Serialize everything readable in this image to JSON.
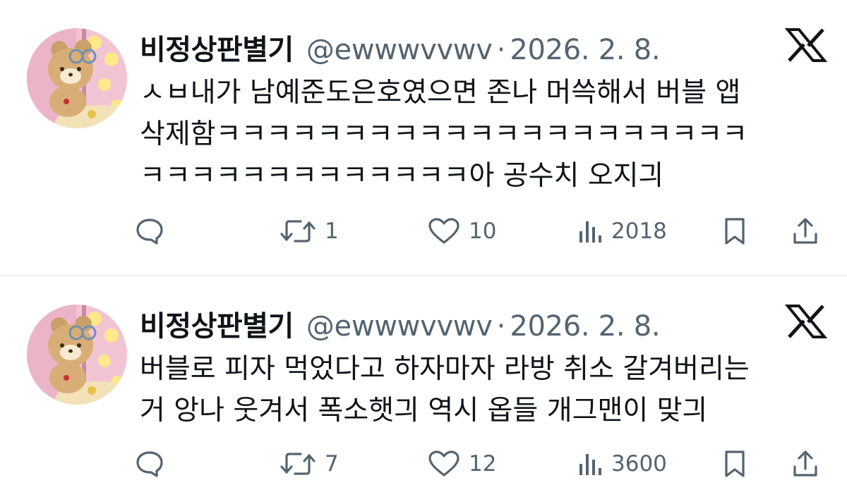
{
  "tweets": [
    {
      "display_name": "비정상판별기",
      "handle": "@ewwwvvwv",
      "separator": "·",
      "date": "2026. 2. 8.",
      "lines": [
        "ㅅㅂ내가 남예준도은호였으면 존나 머쓱해서 버블 앱",
        "삭제함ㅋㅋㅋㅋㅋㅋㅋㅋㅋㅋㅋㅋㅋㅋㅋㅋㅋㅋㅋㅋㅋ",
        "ㅋㅋㅋㅋㅋㅋㅋㅋㅋㅋㅋㅋㅋ아 공수치 오지긔"
      ],
      "replies": "",
      "retweets": "1",
      "likes": "10",
      "views": "2018"
    },
    {
      "display_name": "비정상판별기",
      "handle": "@ewwwvvwv",
      "separator": "·",
      "date": "2026. 2. 8.",
      "lines": [
        "버블로 피자 먹었다고 하자마자 라방 취소 갈겨버리는",
        "거 앙나 웃겨서 폭소햇긔 역시 옵들 개그맨이 맞긔"
      ],
      "replies": "",
      "retweets": "7",
      "likes": "12",
      "views": "3600"
    }
  ],
  "icons": {
    "reply": "speech-bubble-icon",
    "retweet": "repost-arrows-icon",
    "like": "heart-icon",
    "views": "bar-chart-icon",
    "bookmark": "bookmark-icon",
    "share": "share-upload-icon",
    "brand": "x-logo-icon"
  },
  "colors": {
    "text_primary": "#0f1419",
    "text_secondary": "#536471",
    "divider": "#eff3f4",
    "avatar_bg": "#f2c4d3"
  }
}
